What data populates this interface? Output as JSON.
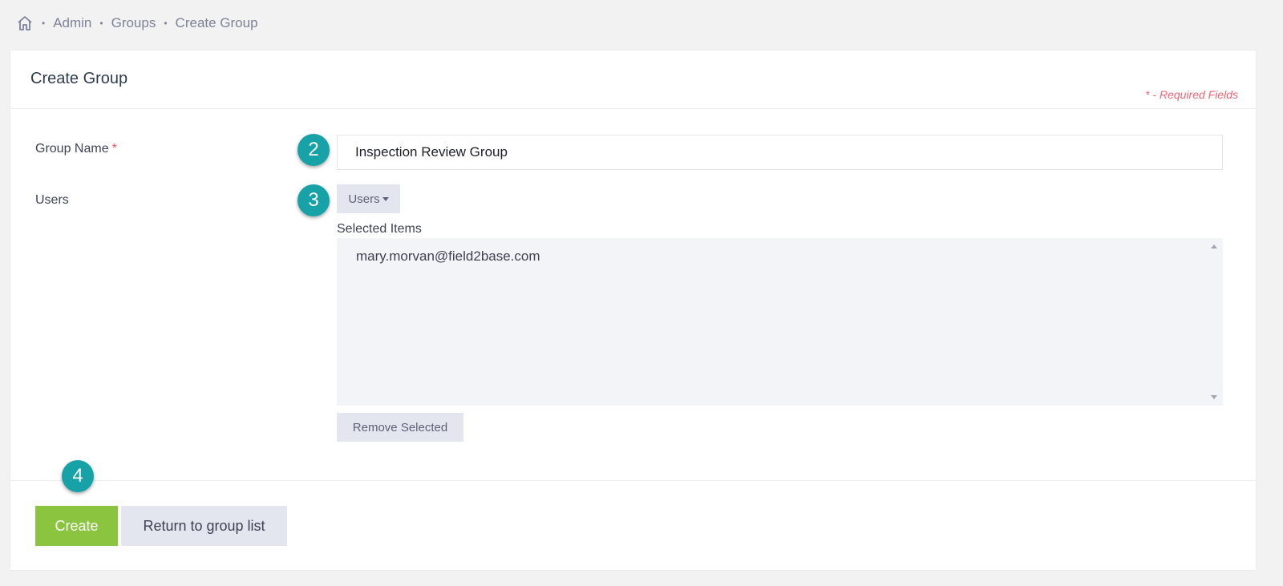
{
  "breadcrumb": {
    "home_icon": "home-icon",
    "items": [
      "Admin",
      "Groups",
      "Create Group"
    ]
  },
  "card": {
    "title": "Create Group",
    "required_note": "* - Required Fields"
  },
  "form": {
    "group_name_label": "Group Name",
    "required_marker": "*",
    "group_name_value": "Inspection Review Group",
    "users_label": "Users",
    "users_button": "Users",
    "selected_items_label": "Selected Items",
    "selected_items": [
      "mary.morvan@field2base.com"
    ],
    "remove_button": "Remove Selected"
  },
  "badges": [
    "2",
    "3",
    "4"
  ],
  "footer": {
    "create_button": "Create",
    "return_button": "Return to group list"
  },
  "colors": {
    "badge": "#17a2a8",
    "create": "#8bc53f",
    "required": "#f64e60"
  }
}
